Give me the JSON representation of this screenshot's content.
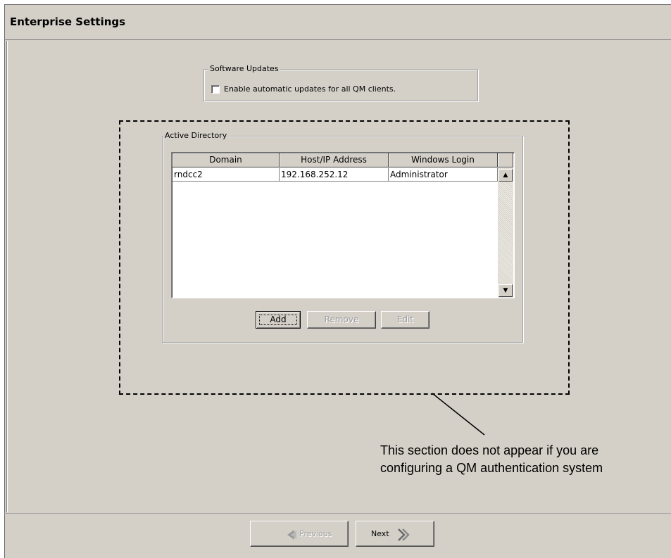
{
  "window": {
    "title": "Enterprise Settings"
  },
  "software_updates": {
    "group_label": "Software Updates",
    "checkbox_label": "Enable automatic updates for all QM clients.",
    "checked": false
  },
  "active_directory": {
    "group_label": "Active Directory",
    "columns": [
      "Domain",
      "Host/IP Address",
      "Windows Login"
    ],
    "rows": [
      {
        "domain": "rndcc2",
        "host": "192.168.252.12",
        "login": "Administrator"
      }
    ],
    "buttons": {
      "add": "Add",
      "remove": "Remove",
      "edit": "Edit"
    }
  },
  "scrollbar": {
    "up_icon": "arrow-up-icon",
    "down_icon": "arrow-down-icon"
  },
  "annotation": {
    "text": "This section does not appear if you are configuring a QM authentication system"
  },
  "navigation": {
    "previous": "Previous",
    "next": "Next"
  }
}
